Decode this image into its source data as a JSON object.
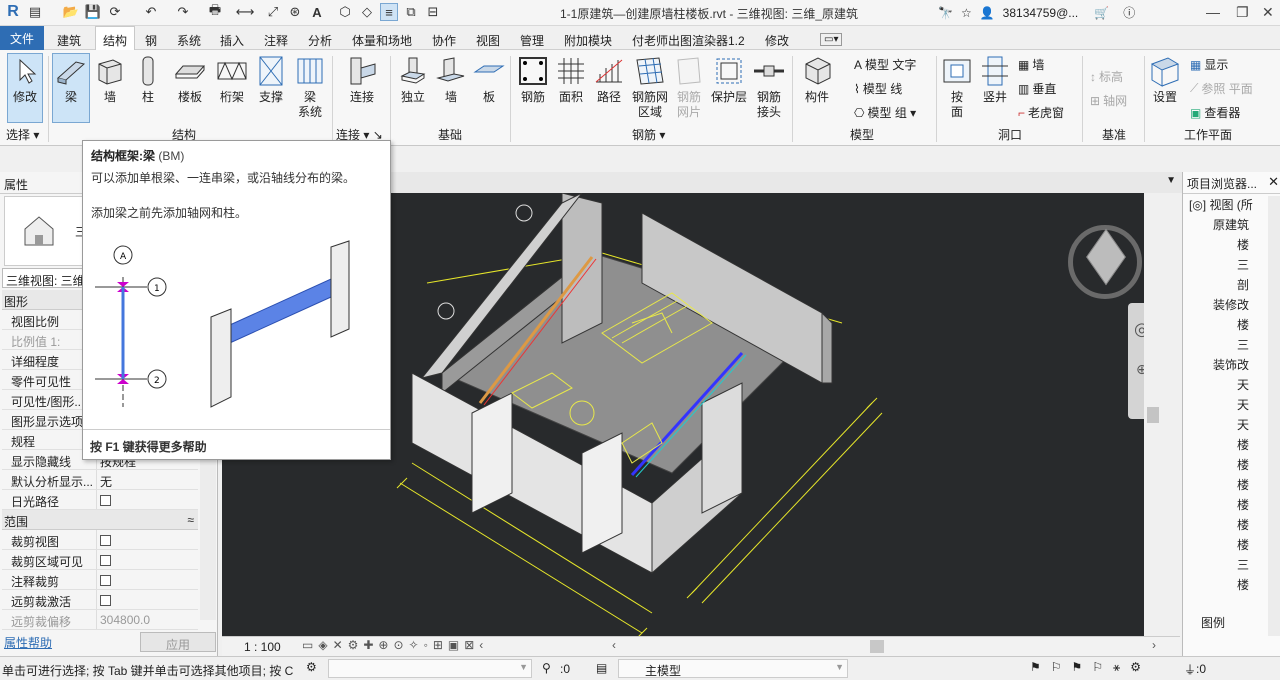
{
  "app": {
    "title": "1-1原建筑—创建原墙柱楼板.rvt - 三维视图: 三维_原建筑",
    "user": "38134759@...",
    "logo": "R"
  },
  "menu": [
    "文件",
    "建筑",
    "结构",
    "钢",
    "系统",
    "插入",
    "注释",
    "分析",
    "体量和场地",
    "协作",
    "视图",
    "管理",
    "附加模块",
    "付老师出图渲染器1.2",
    "修改"
  ],
  "ribbon": {
    "select": {
      "modify": "修改",
      "panel": "选择 ▾"
    },
    "structure": {
      "tools": [
        "梁",
        "墙",
        "柱",
        "楼板",
        "桁架",
        "支撑"
      ],
      "beam_system": [
        "梁",
        "系统"
      ],
      "panel": "结构"
    },
    "connection": {
      "tool": "连接",
      "panel": "连接 ▾ ↘"
    },
    "foundation": {
      "tools": [
        "独立",
        "墙",
        "板"
      ],
      "panel": "基础"
    },
    "rebar": {
      "tools": [
        "钢筋",
        "面积",
        "路径"
      ],
      "area_rebar": [
        "钢筋网",
        "区域"
      ],
      "fabric_sheet": [
        "钢筋",
        "网片"
      ],
      "cover": "保护层",
      "coupler": [
        "钢筋",
        "接头"
      ],
      "panel": "钢筋 ▾"
    },
    "model": {
      "component": "构件",
      "model_text": "模型 文字",
      "model_line": "模型 线",
      "model_group": "模型 组 ▾",
      "panel": "模型"
    },
    "opening": {
      "by_face": [
        "按",
        "面"
      ],
      "shaft": "竖井",
      "wall": "墙",
      "vertical": "垂直",
      "dormer": "老虎窗",
      "panel": "洞口"
    },
    "datum": {
      "level": "标高",
      "grid": "轴网",
      "panel": "基准"
    },
    "workplane": {
      "set": "设置",
      "show": "显示",
      "ref_plane": "参照 平面",
      "viewer": "查看器",
      "panel": "工作平面"
    }
  },
  "tooltip": {
    "title": "结构框架:梁",
    "shortcut": "(BM)",
    "desc": "可以添加单根梁、一连串梁，或沿轴线分布的梁。",
    "hint": "添加梁之前先添加轴网和柱。",
    "footer": "按 F1 键获得更多帮助",
    "grid_a": "A",
    "grid_1": "1",
    "grid_2": "2"
  },
  "properties": {
    "header": "属性",
    "type_partial": "三",
    "view_selector": "三维视图: 三维",
    "section_graphics": "图形",
    "rows": [
      {
        "k": "视图比例",
        "v": ""
      },
      {
        "k": "比例值 1:",
        "v": ""
      },
      {
        "k": "详细程度",
        "v": ""
      },
      {
        "k": "零件可见性",
        "v": ""
      },
      {
        "k": "可见性/图形...",
        "v": ""
      },
      {
        "k": "图形显示选项",
        "v": ""
      },
      {
        "k": "规程",
        "v": ""
      },
      {
        "k": "显示隐藏线",
        "v": "按规程"
      },
      {
        "k": "默认分析显示...",
        "v": "无"
      },
      {
        "k": "日光路径",
        "v": ""
      }
    ],
    "section_extents": "范围",
    "rows2": [
      {
        "k": "裁剪视图",
        "v": ""
      },
      {
        "k": "裁剪区域可见",
        "v": ""
      },
      {
        "k": "注释裁剪",
        "v": ""
      },
      {
        "k": "远剪裁激活",
        "v": ""
      },
      {
        "k": "远剪裁偏移",
        "v": "304800.0"
      }
    ],
    "help": "属性帮助",
    "apply": "应用"
  },
  "view": {
    "scale": "1 : 100"
  },
  "browser": {
    "title": "项目浏览器...",
    "items": [
      "[◎] 视图 (所",
      "原建筑",
      "楼",
      "三",
      "剖",
      "装修改",
      "楼",
      "三",
      "装饰改",
      "天",
      "天",
      "天",
      "楼",
      "楼",
      "楼",
      "楼",
      "楼",
      "楼",
      "三",
      "楼",
      "图例"
    ]
  },
  "status": {
    "hint": "单击可进行选择; 按 Tab 键并单击可选择其他项目; 按 C",
    "filter_count": ":0",
    "model": "主模型",
    "select_count": ":0"
  },
  "colors": {
    "accent": "#2e6db4",
    "viewport": "#282a2c"
  }
}
